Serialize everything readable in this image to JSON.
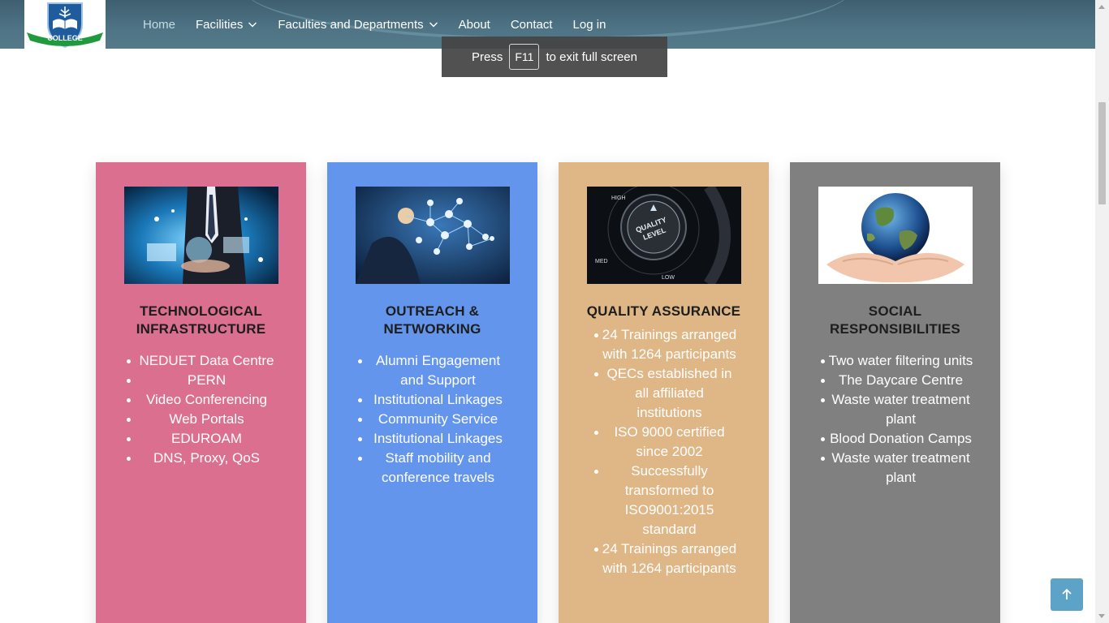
{
  "logo": {
    "text": "COLLEGE"
  },
  "nav": {
    "items": [
      {
        "label": "Home",
        "active": true,
        "dropdown": false
      },
      {
        "label": "Facilities",
        "active": false,
        "dropdown": true
      },
      {
        "label": "Faculties and Departments",
        "active": false,
        "dropdown": true
      },
      {
        "label": "About",
        "active": false,
        "dropdown": false
      },
      {
        "label": "Contact",
        "active": false,
        "dropdown": false
      },
      {
        "label": "Log in",
        "active": false,
        "dropdown": false
      }
    ]
  },
  "fullscreen_toast": {
    "before": "Press",
    "key": "F11",
    "after": "to exit full screen"
  },
  "cards": [
    {
      "title": "TECHNOLOGICAL INFRASTRUCTURE",
      "color": "#db6f8f",
      "items": [
        "NEDUET Data Centre",
        "PERN",
        "Video Conferencing",
        "Web Portals",
        "EDUROAM",
        "DNS, Proxy, QoS"
      ]
    },
    {
      "title": "OUTREACH & NETWORKING",
      "color": "#6495ed",
      "items": [
        "Alumni Engagement and Support",
        "Institutional Linkages",
        "Community Service",
        "Institutional Linkages",
        "Staff mobility and conference travels"
      ]
    },
    {
      "title": "QUALITY ASSURANCE",
      "color": "#dfb786",
      "items": [
        "24 Trainings arranged with 1264 participants",
        "QECs established in all affiliated institutions",
        "ISO 9000 certified since 2002",
        "Successfully transformed to ISO9001:2015 standard",
        "24 Trainings arranged with 1264 participants"
      ],
      "dial": {
        "high": "HIGH",
        "med": "MED",
        "low": "LOW",
        "label1": "QUALITY",
        "label2": "LEVEL"
      }
    },
    {
      "title": "SOCIAL RESPONSIBILITIES",
      "color": "#808080",
      "items": [
        "Two water filtering units",
        "The Daycare Centre",
        "Waste water treatment plant",
        "Blood Donation Camps",
        "Waste water treatment plant"
      ]
    }
  ],
  "colors": {
    "header": "#4e7485",
    "back_to_top": "#5da3c8",
    "toast": "#444444"
  },
  "icons": [
    "chevron-down-icon",
    "arrow-up-icon"
  ]
}
